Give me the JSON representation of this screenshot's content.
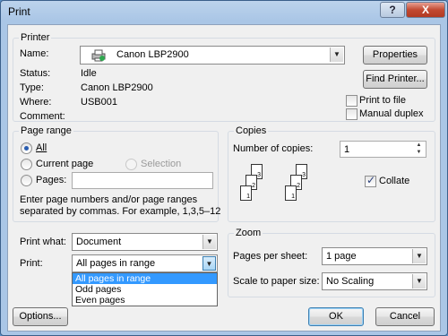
{
  "window": {
    "title": "Print",
    "help_label": "?",
    "close_label": "X"
  },
  "printer": {
    "group_label": "Printer",
    "name_label": "Name:",
    "name_value": "Canon LBP2900",
    "status_label": "Status:",
    "status_value": "Idle",
    "type_label": "Type:",
    "type_value": "Canon LBP2900",
    "where_label": "Where:",
    "where_value": "USB001",
    "comment_label": "Comment:",
    "comment_value": "",
    "properties_label": "Properties",
    "find_printer_label": "Find Printer...",
    "print_to_file_label": "Print to file",
    "manual_duplex_label": "Manual duplex"
  },
  "page_range": {
    "group_label": "Page range",
    "all_label": "All",
    "current_page_label": "Current page",
    "selection_label": "Selection",
    "pages_label": "Pages:",
    "pages_value": "",
    "help_text_1": "Enter page numbers and/or page ranges",
    "help_text_2": "separated by commas.  For example, 1,3,5–12"
  },
  "copies": {
    "group_label": "Copies",
    "number_label": "Number of copies:",
    "number_value": "1",
    "collate_label": "Collate",
    "collate_checked": true,
    "page_numbers": [
      "3",
      "2",
      "1",
      "3",
      "2",
      "1"
    ]
  },
  "print_options": {
    "print_what_label": "Print what:",
    "print_what_value": "Document",
    "print_label": "Print:",
    "print_value": "All pages in range",
    "print_options_list": [
      "All pages in range",
      "Odd pages",
      "Even pages"
    ]
  },
  "zoom": {
    "group_label": "Zoom",
    "pages_per_sheet_label": "Pages per sheet:",
    "pages_per_sheet_value": "1 page",
    "scale_label": "Scale to paper size:",
    "scale_value": "No Scaling"
  },
  "footer": {
    "options_label": "Options...",
    "ok_label": "OK",
    "cancel_label": "Cancel"
  }
}
